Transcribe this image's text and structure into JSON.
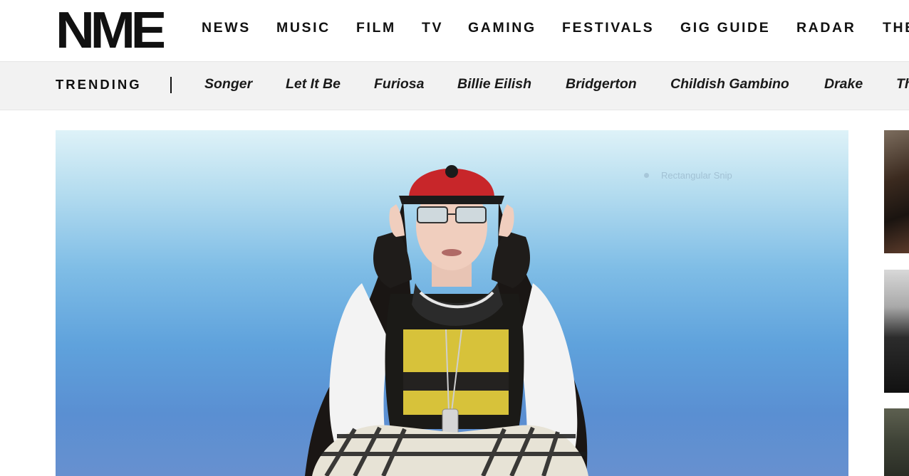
{
  "header": {
    "logo_text": "NME",
    "nav": [
      "NEWS",
      "MUSIC",
      "FILM",
      "TV",
      "GAMING",
      "FESTIVALS",
      "GIG GUIDE",
      "RADAR",
      "THE"
    ]
  },
  "trending": {
    "label": "TRENDING",
    "items": [
      "Songer",
      "Let It Be",
      "Furiosa",
      "Billie Eilish",
      "Bridgerton",
      "Childish Gambino",
      "Drake",
      "Th"
    ]
  },
  "hero": {
    "overlay_text": "Rectangular Snip"
  },
  "colors": {
    "brand": "#111111",
    "trending_bg": "#f2f2f2",
    "cap_red": "#c8262a"
  },
  "icons": [
    "nme-logo-icon"
  ]
}
